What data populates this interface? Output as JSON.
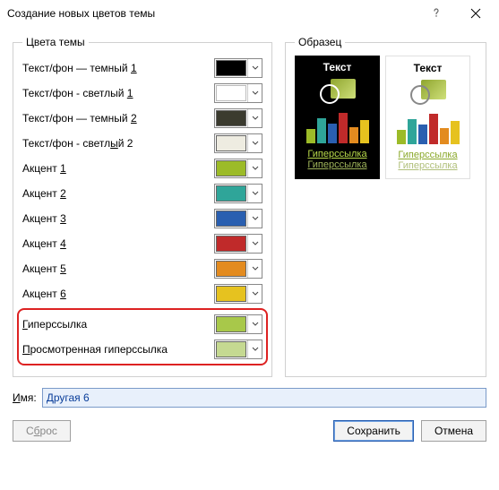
{
  "title": "Создание новых цветов темы",
  "groups": {
    "themeColors": "Цвета темы",
    "sample": "Образец"
  },
  "rows": {
    "r0": {
      "label": "Текст/фон — темный 1",
      "accel": "1",
      "color": "#000000"
    },
    "r1": {
      "label": "Текст/фон - светлый 1",
      "accel": "1",
      "color": "#ffffff"
    },
    "r2": {
      "label": "Текст/фон — темный 2",
      "accel": "2",
      "color": "#3b3b2f"
    },
    "r3": {
      "label": "Текст/фон - светлый 2",
      "accel": "2",
      "color": "#eeece1"
    },
    "r4": {
      "label": "Акцент 1",
      "accel": "1",
      "color": "#9cbb28"
    },
    "r5": {
      "label": "Акцент 2",
      "accel": "2",
      "color": "#2fa599"
    },
    "r6": {
      "label": "Акцент 3",
      "accel": "3",
      "color": "#2a5fb0"
    },
    "r7": {
      "label": "Акцент 4",
      "accel": "4",
      "color": "#c02a2a"
    },
    "r8": {
      "label": "Акцент 5",
      "accel": "5",
      "color": "#e38b1f"
    },
    "r9": {
      "label": "Акцент 6",
      "accel": "6",
      "color": "#e6c21f"
    },
    "r10": {
      "label": "Гиперссылка",
      "accel": "Г",
      "color": "#a8c84a"
    },
    "r11": {
      "label": "Просмотренная гиперссылка",
      "accel": "П",
      "color": "#c5d991"
    }
  },
  "preview": {
    "text": "Текст",
    "hyperlink": "Гиперссылка",
    "visited": "Гиперссылка"
  },
  "nameLabel": "Имя:",
  "nameAccel": "И",
  "nameValue": "Другая 6",
  "buttons": {
    "reset": "Сброс",
    "resetAccel": "б",
    "save": "Сохранить",
    "cancel": "Отмена"
  }
}
